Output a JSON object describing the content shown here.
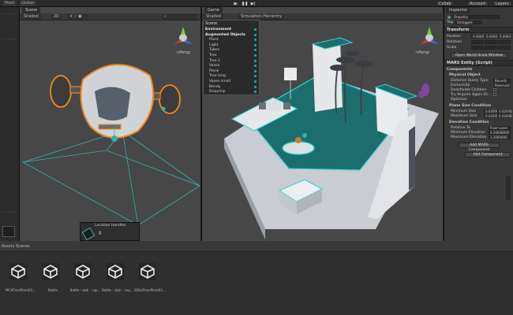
{
  "toolbar": {
    "tabs": [
      "Pivot",
      "Global"
    ],
    "play": "▶",
    "pause": "❚❚",
    "step": "▶|",
    "right_buttons": [
      "Collab",
      "Account",
      "Layers"
    ]
  },
  "scene": {
    "tab": "Scene",
    "shading": "Shaded",
    "mode": "2D",
    "persp": "<Persp",
    "popup_title": "Location Handles"
  },
  "game": {
    "tab": "Game",
    "shading": "Shaded",
    "bar_label": "Simulation Hierarchy",
    "persp": "<Persp"
  },
  "hierarchy": {
    "title": "Scene",
    "items": [
      {
        "label": "Environment",
        "bold": true
      },
      {
        "label": "Augmented Objects",
        "bold": true
      },
      {
        "label": "Plant",
        "bold": false
      },
      {
        "label": "Light",
        "bold": false
      },
      {
        "label": "Tubes",
        "bold": false
      },
      {
        "label": "Tree",
        "bold": false
      },
      {
        "label": "Tree 2",
        "bold": false
      },
      {
        "label": "Vases",
        "bold": false
      },
      {
        "label": "Plank",
        "bold": false
      },
      {
        "label": "Tree long",
        "bold": false
      },
      {
        "label": "Vases small",
        "bold": false
      },
      {
        "label": "Bendy",
        "bold": false
      },
      {
        "label": "Dropship",
        "bold": false
      }
    ]
  },
  "inspector": {
    "tab": "Inspector",
    "object_name": "Dropship",
    "tag_label": "Tag",
    "tag_value": "Untagged",
    "transform": "Transform",
    "position": "Position",
    "rotation": "Rotation",
    "scale": "Scale",
    "pos_vals": [
      "0.0000",
      "0.0000",
      "0.0000"
    ],
    "open_btn": "Open World Scale Window",
    "mars_entity": "MARS Entity (Script)",
    "components": "Components",
    "physical_object": "Physical Object",
    "phys_rows": [
      "Distance Query Type",
      "Exclusivity",
      "Deactivate Children",
      "Try Acquire Again Oc...",
      "Optimize"
    ],
    "phys_vals": [
      "Bounds",
      "Reserved"
    ],
    "plane_size": "Plane Size Condition",
    "plane_rows": [
      "Minimum Size",
      "Maximum Size"
    ],
    "plane_vals": [
      "0.02000",
      "0.02000",
      "0.02000",
      "0.02000"
    ],
    "elevation": "Elevation Condition",
    "elev_rows": [
      "Relative To",
      "Minimum Elevation",
      "Maximum Elevation"
    ],
    "elev_vals": [
      "Floor Level",
      "0.20000000",
      "1.2000000"
    ],
    "add_mars": "Add MARS Component",
    "add_component": "Add Component"
  },
  "project": {
    "tabs": [
      "Assets",
      "Scenes"
    ],
    "assets": [
      "MCAFlorePlant03...",
      "Battle",
      "Battle - wall - cap...",
      "Battle - stair - cap...",
      "ElDolFloorPlant03..."
    ]
  }
}
